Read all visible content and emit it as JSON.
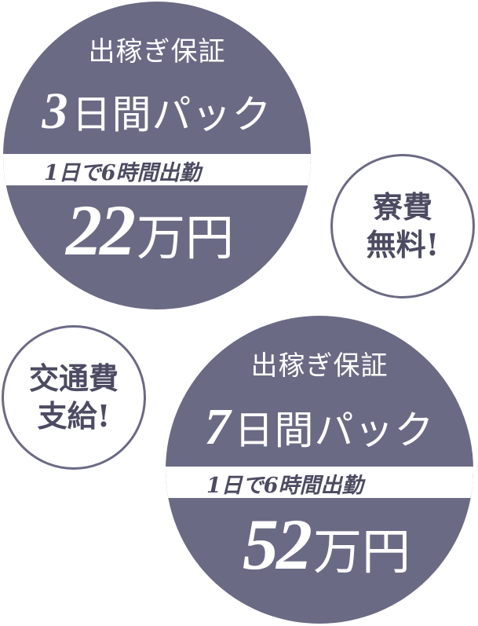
{
  "colors": {
    "circle": "#6b6a84",
    "band_text": "#4c4b62",
    "background": "#ffffff"
  },
  "plan_3day": {
    "label": "出稼ぎ保証",
    "days": "3",
    "pack_suffix": "日間パック",
    "condition": "1日で6時間出勤",
    "amount": "22",
    "unit": "万円"
  },
  "plan_7day": {
    "label": "出稼ぎ保証",
    "days": "7",
    "pack_suffix": "日間パック",
    "condition": "1日で6時間出勤",
    "amount": "52",
    "unit": "万円"
  },
  "badge_dorm": {
    "line1": "寮費",
    "line2": "無料!"
  },
  "badge_transport": {
    "line1": "交通費",
    "line2": "支給!"
  }
}
